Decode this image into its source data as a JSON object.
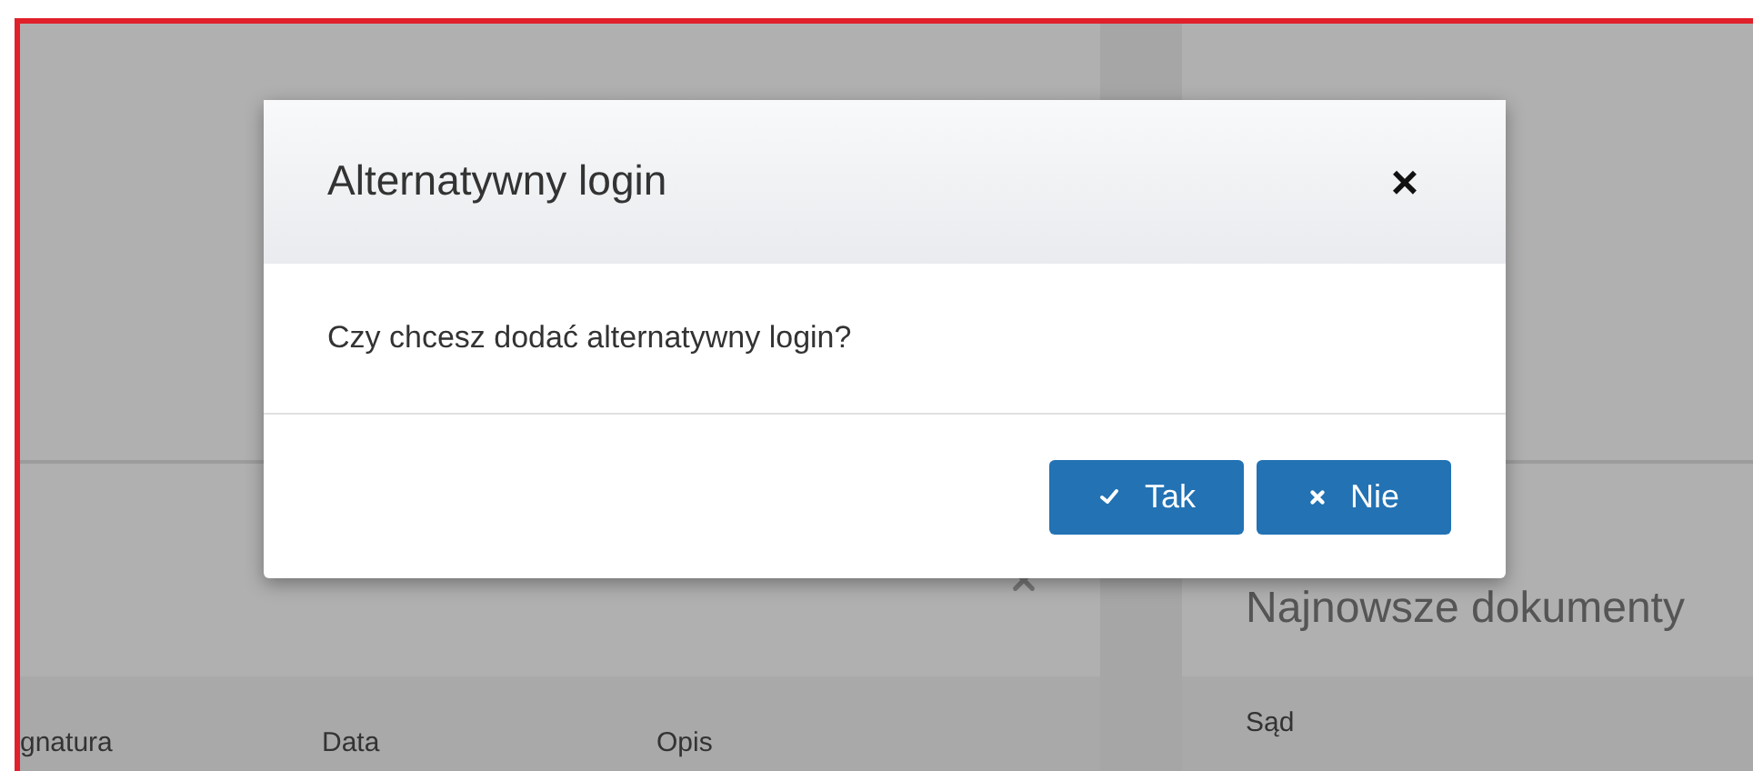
{
  "background": {
    "left_panel": {
      "columns": [
        "gnatura",
        "Data",
        "Opis"
      ]
    },
    "right_panel": {
      "title": "Najnowsze dokumenty",
      "columns": [
        "Sąd"
      ]
    }
  },
  "dialog": {
    "title": "Alternatywny login",
    "close": "×",
    "message": "Czy chcesz dodać alternatywny login?",
    "buttons": [
      {
        "label": "Tak",
        "kind": "confirm"
      },
      {
        "label": "Nie",
        "kind": "cancel"
      }
    ]
  }
}
